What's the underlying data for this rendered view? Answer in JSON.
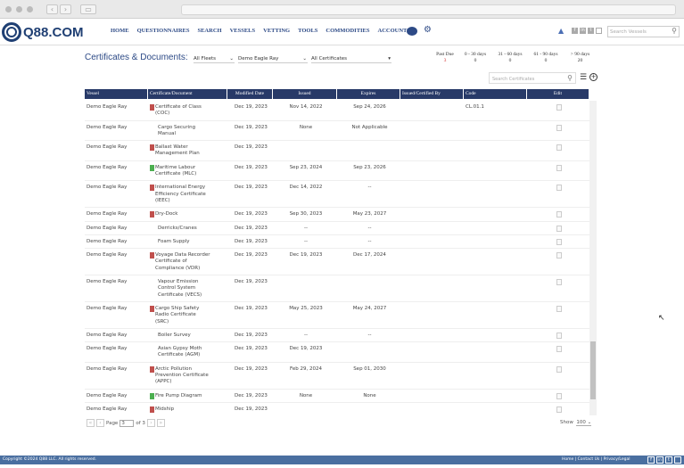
{
  "browser": {
    "url": ""
  },
  "nav": {
    "logo": "Q88.COM",
    "items": [
      "HOME",
      "QUESTIONNAIRES",
      "SEARCH",
      "VESSELS",
      "VETTING",
      "TOOLS",
      "COMMODITIES",
      "ACCOUNT"
    ],
    "search_placeholder": "Search Vessels"
  },
  "page": {
    "title": "Certificates & Documents:",
    "fleet": "All Fleets",
    "vessel": "Demo Eagle Ray",
    "certificates": "All Certificates",
    "search_placeholder": "Search Certificates"
  },
  "due": [
    {
      "label": "Past Due",
      "value": "3",
      "color": "#d32f2f"
    },
    {
      "label": "0 - 30 days",
      "value": "0"
    },
    {
      "label": "31 - 60 days",
      "value": "0"
    },
    {
      "label": "61 - 90 days",
      "value": "0"
    },
    {
      "label": "> 90 days",
      "value": "20"
    }
  ],
  "columns": [
    "Vessel",
    "Certificate/Document",
    "Modified Date",
    "Issued",
    "Expires",
    "Issued/Certified By",
    "Code",
    "Edit"
  ],
  "rows": [
    {
      "vessel": "Demo Eagle Ray",
      "cert": "Certificate of Class (COC)",
      "icon": "red",
      "modified": "Dec 19, 2023",
      "issued": "Nov 14, 2022",
      "expires": "Sep 24, 2026",
      "by": "",
      "code": "CL.01.1"
    },
    {
      "vessel": "Demo Eagle Ray",
      "cert": "Cargo Securing Manual",
      "icon": "",
      "modified": "Dec 19, 2023",
      "issued": "None",
      "expires": "Not Applicable",
      "by": "",
      "code": ""
    },
    {
      "vessel": "Demo Eagle Ray",
      "cert": "Ballast Water Management Plan",
      "icon": "red",
      "modified": "Dec 19, 2023",
      "issued": "",
      "expires": "",
      "by": "",
      "code": ""
    },
    {
      "vessel": "Demo Eagle Ray",
      "cert": "Maritime Labour Certificate (MLC)",
      "icon": "green",
      "modified": "Dec 19, 2023",
      "issued": "Sep 23, 2024",
      "expires": "Sep 23, 2026",
      "by": "",
      "code": ""
    },
    {
      "vessel": "Demo Eagle Ray",
      "cert": "International Energy Efficiency Certificate (IEEC)",
      "icon": "red",
      "modified": "Dec 19, 2023",
      "issued": "Dec 14, 2022",
      "expires": "--",
      "by": "",
      "code": ""
    },
    {
      "vessel": "Demo Eagle Ray",
      "cert": "Dry-Dock",
      "icon": "red",
      "modified": "Dec 19, 2023",
      "issued": "Sep 30, 2023",
      "expires": "May 23, 2027",
      "by": "",
      "code": ""
    },
    {
      "vessel": "Demo Eagle Ray",
      "cert": "Derricks/Cranes",
      "icon": "",
      "modified": "Dec 19, 2023",
      "issued": "--",
      "expires": "--",
      "by": "",
      "code": ""
    },
    {
      "vessel": "Demo Eagle Ray",
      "cert": "Foam Supply",
      "icon": "",
      "modified": "Dec 19, 2023",
      "issued": "--",
      "expires": "--",
      "by": "",
      "code": ""
    },
    {
      "vessel": "Demo Eagle Ray",
      "cert": "Voyage Data Recorder Certificate of Compliance (VDR)",
      "icon": "red",
      "modified": "Dec 19, 2023",
      "issued": "Dec 19, 2023",
      "expires": "Dec 17, 2024",
      "by": "",
      "code": ""
    },
    {
      "vessel": "Demo Eagle Ray",
      "cert": "Vapour Emission Control System Certificate (VECS)",
      "icon": "",
      "modified": "Dec 19, 2023",
      "issued": "",
      "expires": "",
      "by": "",
      "code": ""
    },
    {
      "vessel": "Demo Eagle Ray",
      "cert": "Cargo Ship Safety Radio Certificate (SRC)",
      "icon": "red",
      "modified": "Dec 19, 2023",
      "issued": "May 25, 2023",
      "expires": "May 24, 2027",
      "by": "",
      "code": ""
    },
    {
      "vessel": "Demo Eagle Ray",
      "cert": "Boiler Survey",
      "icon": "",
      "modified": "Dec 19, 2023",
      "issued": "--",
      "expires": "--",
      "by": "",
      "code": ""
    },
    {
      "vessel": "Demo Eagle Ray",
      "cert": "Asian Gypsy Moth Certificate (AGM)",
      "icon": "",
      "modified": "Dec 19, 2023",
      "issued": "Dec 19, 2023",
      "expires": "",
      "by": "",
      "code": ""
    },
    {
      "vessel": "Demo Eagle Ray",
      "cert": "Arctic Pollution Prevention Certificate (APPC)",
      "icon": "red",
      "modified": "Dec 19, 2023",
      "issued": "Feb 29, 2024",
      "expires": "Sep 01, 2030",
      "by": "",
      "code": ""
    },
    {
      "vessel": "Demo Eagle Ray",
      "cert": "Fire Pump Diagram",
      "icon": "green",
      "modified": "Dec 19, 2023",
      "issued": "None",
      "expires": "None",
      "by": "",
      "code": ""
    },
    {
      "vessel": "Demo Eagle Ray",
      "cert": "Midship",
      "icon": "red",
      "modified": "Dec 19, 2023",
      "issued": "",
      "expires": "",
      "by": "",
      "code": ""
    }
  ],
  "pager": {
    "page_label": "Page",
    "page": "3",
    "of": "of 3",
    "show_label": "Show",
    "show_value": "100"
  },
  "footer": {
    "copyright": "Copyright ©2024 Q88 LLC. All rights reserved.",
    "links": "Home | Contact Us | Privacy/Legal"
  },
  "colors": {
    "header": "#283a68",
    "brand": "#1f3f73",
    "footer": "#4a6fa0",
    "icon_red": "#c0504d",
    "icon_green": "#4caf50"
  }
}
